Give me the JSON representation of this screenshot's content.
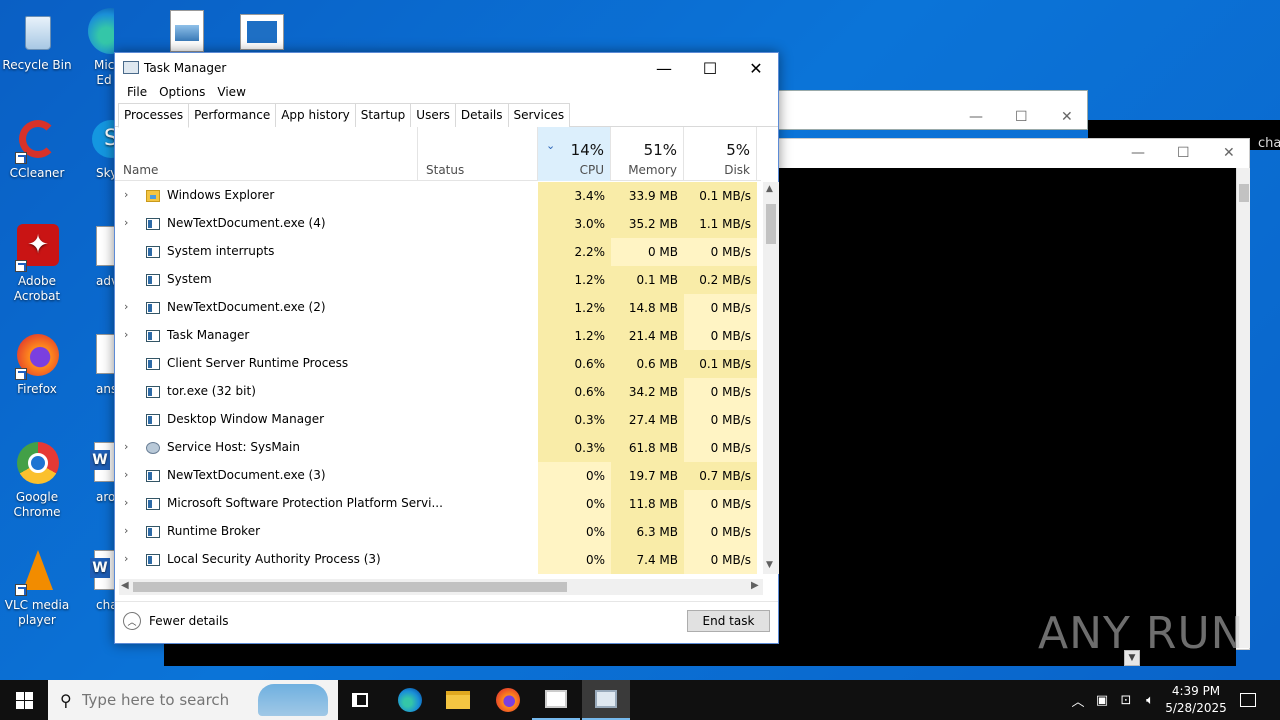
{
  "desktop": {
    "icons": [
      {
        "label": "Recycle Bin",
        "icon": "recycle-bin-icon"
      },
      {
        "label": "CCleaner",
        "icon": "ccleaner-icon"
      },
      {
        "label": "Adobe Acrobat",
        "icon": "adobe-acrobat-icon"
      },
      {
        "label": "Firefox",
        "icon": "firefox-icon"
      },
      {
        "label": "Google Chrome",
        "icon": "chrome-icon"
      },
      {
        "label": "VLC media player",
        "icon": "vlc-icon"
      },
      {
        "label": "Micro Ed",
        "icon": "edge-icon"
      },
      {
        "label": "Sky",
        "icon": "skype-icon"
      },
      {
        "label": "advic",
        "icon": "document-icon"
      },
      {
        "label": "answe",
        "icon": "document-icon"
      },
      {
        "label": "around",
        "icon": "word-icon"
      },
      {
        "label": "charge",
        "icon": "word-icon"
      }
    ]
  },
  "background": {
    "console_text": "cha"
  },
  "task_manager": {
    "title": "Task Manager",
    "menu": [
      "File",
      "Options",
      "View"
    ],
    "tabs": [
      "Processes",
      "Performance",
      "App history",
      "Startup",
      "Users",
      "Details",
      "Services"
    ],
    "active_tab": "Processes",
    "columns": {
      "name": "Name",
      "status": "Status",
      "cpu_pct": "14%",
      "cpu": "CPU",
      "mem_pct": "51%",
      "mem": "Memory",
      "disk_pct": "5%",
      "disk": "Disk"
    },
    "processes": [
      {
        "name": "Windows Explorer",
        "expandable": true,
        "cpu": "3.4%",
        "mem": "33.9 MB",
        "disk": "0.1 MB/s",
        "icon": "folder-icon"
      },
      {
        "name": "NewTextDocument.exe (4)",
        "expandable": true,
        "cpu": "3.0%",
        "mem": "35.2 MB",
        "disk": "1.1 MB/s",
        "icon": "app-icon"
      },
      {
        "name": "System interrupts",
        "expandable": false,
        "cpu": "2.2%",
        "mem": "0 MB",
        "disk": "0 MB/s",
        "icon": "app-icon"
      },
      {
        "name": "System",
        "expandable": false,
        "cpu": "1.2%",
        "mem": "0.1 MB",
        "disk": "0.2 MB/s",
        "icon": "app-icon"
      },
      {
        "name": "NewTextDocument.exe (2)",
        "expandable": true,
        "cpu": "1.2%",
        "mem": "14.8 MB",
        "disk": "0 MB/s",
        "icon": "app-icon"
      },
      {
        "name": "Task Manager",
        "expandable": true,
        "cpu": "1.2%",
        "mem": "21.4 MB",
        "disk": "0 MB/s",
        "icon": "task-manager-icon"
      },
      {
        "name": "Client Server Runtime Process",
        "expandable": false,
        "cpu": "0.6%",
        "mem": "0.6 MB",
        "disk": "0.1 MB/s",
        "icon": "app-icon"
      },
      {
        "name": "tor.exe (32 bit)",
        "expandable": false,
        "cpu": "0.6%",
        "mem": "34.2 MB",
        "disk": "0 MB/s",
        "icon": "app-icon"
      },
      {
        "name": "Desktop Window Manager",
        "expandable": false,
        "cpu": "0.3%",
        "mem": "27.4 MB",
        "disk": "0 MB/s",
        "icon": "app-icon"
      },
      {
        "name": "Service Host: SysMain",
        "expandable": true,
        "cpu": "0.3%",
        "mem": "61.8 MB",
        "disk": "0 MB/s",
        "icon": "gear-icon"
      },
      {
        "name": "NewTextDocument.exe (3)",
        "expandable": true,
        "cpu": "0%",
        "mem": "19.7 MB",
        "disk": "0.7 MB/s",
        "icon": "app-icon"
      },
      {
        "name": "Microsoft Software Protection Platform Servi...",
        "expandable": true,
        "cpu": "0%",
        "mem": "11.8 MB",
        "disk": "0 MB/s",
        "icon": "app-icon"
      },
      {
        "name": "Runtime Broker",
        "expandable": true,
        "cpu": "0%",
        "mem": "6.3 MB",
        "disk": "0 MB/s",
        "icon": "app-icon"
      },
      {
        "name": "Local Security Authority Process (3)",
        "expandable": true,
        "cpu": "0%",
        "mem": "7.4 MB",
        "disk": "0 MB/s",
        "icon": "app-icon"
      }
    ],
    "footer": {
      "fewer_details": "Fewer details",
      "end_task": "End task"
    }
  },
  "watermark": "ANY RUN",
  "taskbar": {
    "search_placeholder": "Type here to search",
    "time": "4:39 PM",
    "date": "5/28/2025"
  }
}
